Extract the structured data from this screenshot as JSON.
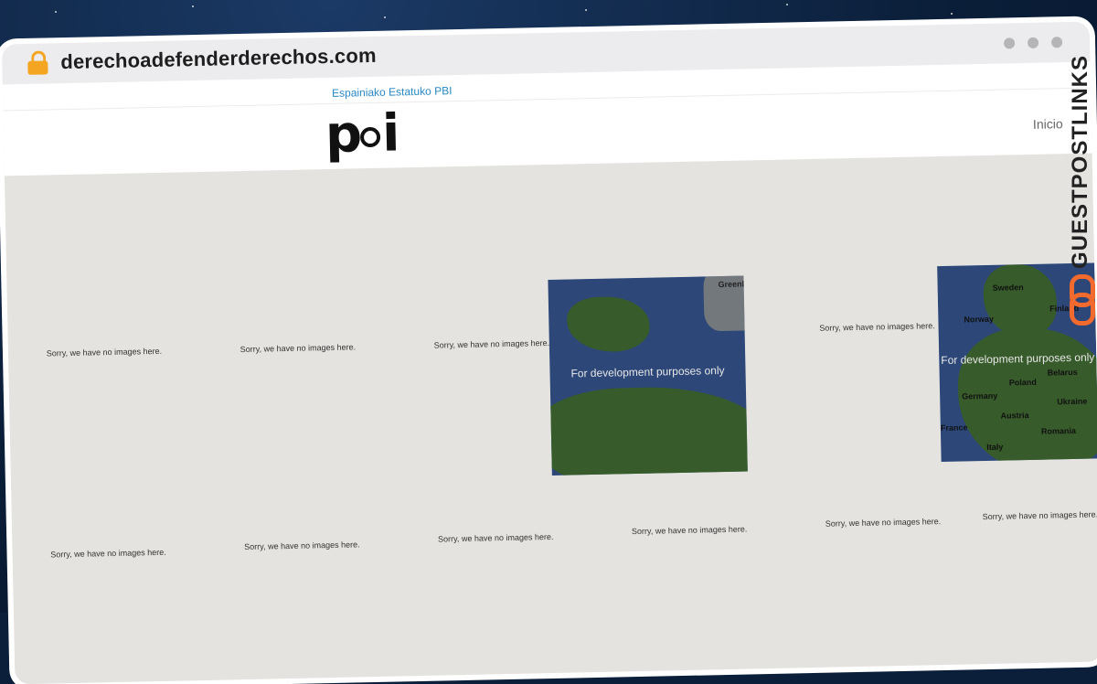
{
  "browser": {
    "url": "derechoadefenderderechos.com"
  },
  "site": {
    "region_link": "Espainiako Estatuko PBI",
    "logo_text": "pbi",
    "nav": {
      "inicio": "Inicio"
    }
  },
  "gallery": {
    "placeholder_text": "Sorry, we have no images here.",
    "map_watermark": "For development purposes only",
    "map1_labels": [
      "Greenl"
    ],
    "map2_labels": [
      "Sweden",
      "Finland",
      "Norway",
      "Poland",
      "Belarus",
      "Germany",
      "Ukraine",
      "Austria",
      "Romania",
      "France",
      "Italy"
    ]
  },
  "overlay": {
    "brand": "GUESTPOSTLINKS"
  },
  "colors": {
    "accent": "#2a89c4",
    "brand_orange": "#f26a2e"
  }
}
